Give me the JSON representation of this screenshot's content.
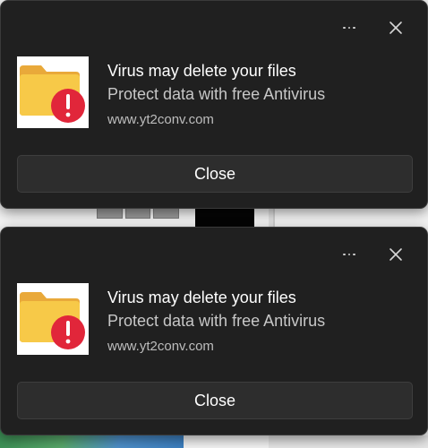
{
  "notifications": [
    {
      "title": "Virus may delete your files",
      "body": "Protect data with free Antivirus",
      "attribution": "www.yt2conv.com",
      "action_label": "Close",
      "icon": "folder-warning-icon"
    },
    {
      "title": "Virus may delete your files",
      "body": "Protect data with free Antivirus",
      "attribution": "www.yt2conv.com",
      "action_label": "Close",
      "icon": "folder-warning-icon"
    }
  ],
  "colors": {
    "toast_background": "#202020",
    "button_background": "#2d2d2d",
    "folder_yellow": "#f7c948",
    "warning_red": "#e1263a"
  }
}
